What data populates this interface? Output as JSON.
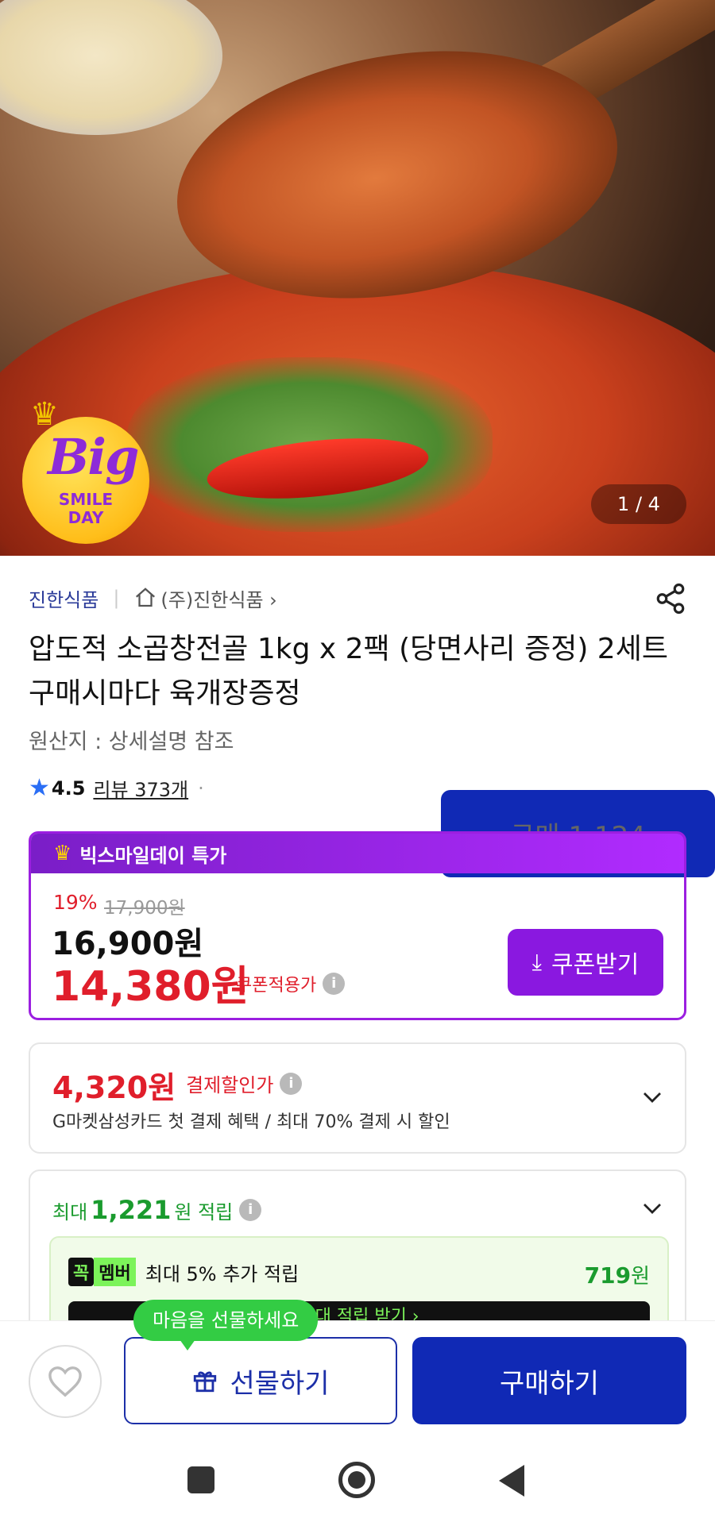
{
  "hero": {
    "badge": {
      "line1": "Big",
      "line2": "SMILE",
      "line3": "DAY"
    },
    "pager": "1 / 4"
  },
  "seller": {
    "name": "진한식품",
    "store": "(주)진한식품 ›"
  },
  "product": {
    "title": "압도적 소곱창전골 1kg x 2팩 (당면사리 증정) 2세트구매시마다 육개장증정",
    "origin": "원산지 : 상세설명 참조",
    "rating": "4.5",
    "reviews": "리뷰 373개",
    "purchases": "구매 1,124"
  },
  "pricebox": {
    "header": "빅스마일데이 특가",
    "discount": "19%",
    "original": "17,900원",
    "price": "16,900원",
    "coupon_price": "14,380원",
    "coupon_label": "쿠폰적용가",
    "coupon_button": "쿠폰받기"
  },
  "payment": {
    "price": "4,320원",
    "label": "결제할인가",
    "desc": "G마켓삼성카드 첫 결제 혜택 / 최대 70% 결제 시 할인"
  },
  "points": {
    "prefix": "최대",
    "amount": "1,221",
    "suffix": "원 적립",
    "member_tag1": "꼭",
    "member_tag2": "멤버",
    "member_text": "최대 5% 추가 적립",
    "member_amount": "719",
    "member_unit": "원",
    "black_bar": "최대 적립 받기 ›"
  },
  "bottom": {
    "bubble": "마음을 선물하세요",
    "gift": "선물하기",
    "buy": "구매하기"
  },
  "colors": {
    "accent_purple": "#8a18e0",
    "price_red": "#e01e2b",
    "buy_blue": "#1029b5",
    "green": "#1a9b2e"
  }
}
